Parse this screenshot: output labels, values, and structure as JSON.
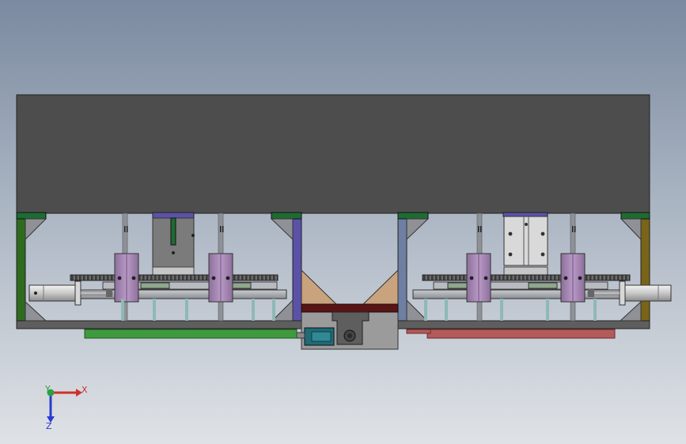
{
  "colors": {
    "top_plate": "#4d4d4d",
    "frame_left": "#2e6b1f",
    "frame_right": "#7a6418",
    "green_cap": "#1e6b34",
    "violet_post": "#5b52a8",
    "slate_post": "#6e7fa3",
    "slider_block": "#a78bb3",
    "rail": "#5a5a5a",
    "green_strip": "#3f9a3f",
    "red_strip": "#b35a5a",
    "dark_red_bar": "#5a1414",
    "tan_wedge": "#c9a27e",
    "cylinder_teal": "#1f6b78",
    "axis_x": "#d0302a",
    "axis_y": "#2ea043",
    "axis_z": "#2a3bd0"
  },
  "axis_triad": {
    "x_label": "X",
    "y_label": "Y",
    "z_label": "Z"
  }
}
